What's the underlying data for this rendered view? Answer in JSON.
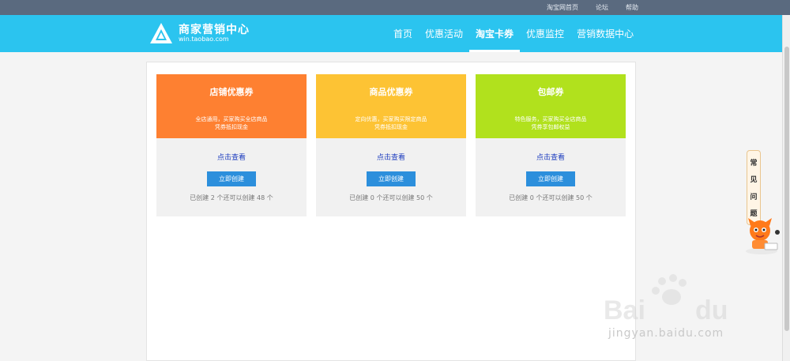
{
  "topbar": {
    "links": [
      "淘宝网首页",
      "论坛",
      "帮助"
    ]
  },
  "logo": {
    "title": "商家营销中心",
    "url": "win.taobao.com"
  },
  "nav": [
    "首页",
    "优惠活动",
    "淘宝卡券",
    "优惠监控",
    "营销数据中心"
  ],
  "cards": [
    {
      "title": "店铺优惠券",
      "desc1": "全店通用，买家购买全店商品",
      "desc2": "凭券抵扣现金",
      "view": "点击查看",
      "create": "立即创建",
      "stat": "已创建 2 个还可以创建 48 个",
      "color": "#fe8031"
    },
    {
      "title": "商品优惠券",
      "desc1": "定向优惠，买家购买限定商品",
      "desc2": "凭券抵扣现金",
      "view": "点击查看",
      "create": "立即创建",
      "stat": "已创建 0 个还可以创建 50 个",
      "color": "#fdc334"
    },
    {
      "title": "包邮券",
      "desc1": "特色服务，买家购买全店商品",
      "desc2": "凭券享包邮权益",
      "view": "点击查看",
      "create": "立即创建",
      "stat": "已创建 0 个还可以创建 50 个",
      "color": "#b1e11d"
    }
  ],
  "faq": [
    "常",
    "见",
    "问",
    "题"
  ],
  "watermark": "jingyan.baidu.com"
}
